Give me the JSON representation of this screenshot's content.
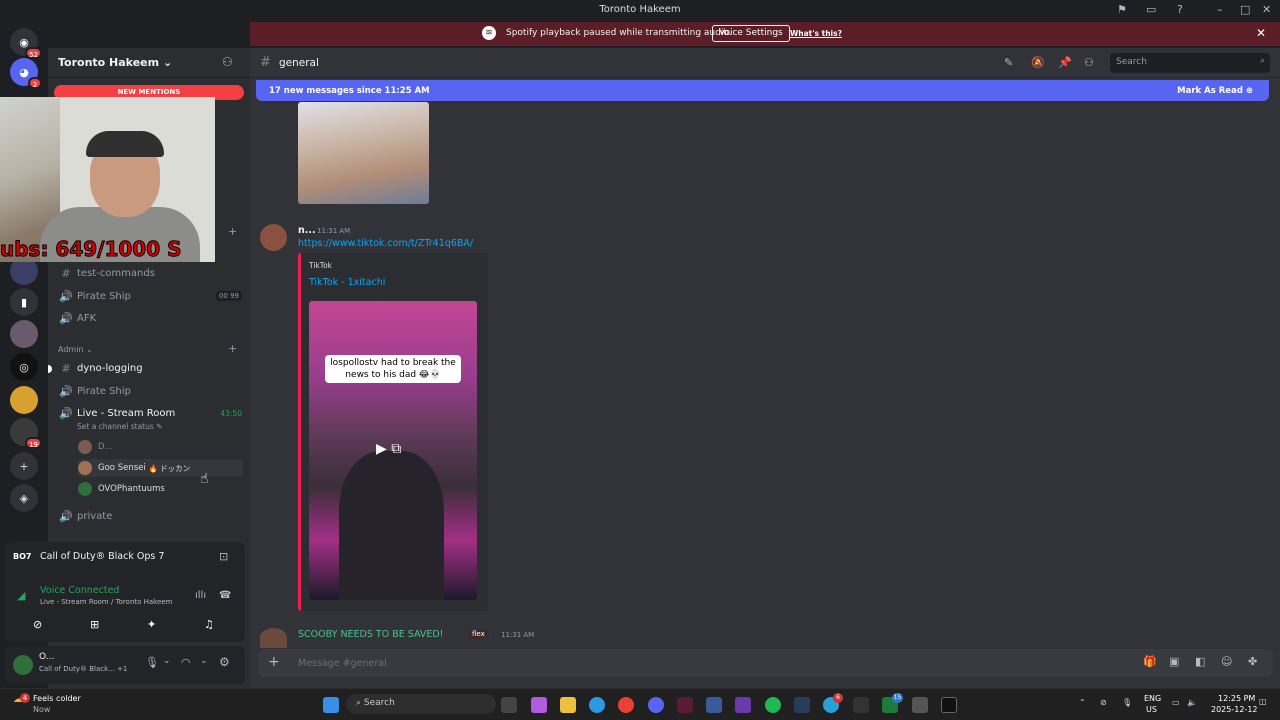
{
  "window": {
    "title": "Toronto Hakeem"
  },
  "notice": {
    "text": "Spotify playback paused while transmitting audio.",
    "voice_settings": "Voice Settings",
    "whats_this": "What's this?"
  },
  "server": {
    "name": "Toronto Hakeem",
    "new_mentions": "NEW MENTIONS"
  },
  "rail_badges": {
    "dm": "52",
    "discord": "2",
    "b1": "19"
  },
  "webcam": {
    "overlay_text": "ubs: 649/1000  S"
  },
  "channels": [
    {
      "icon": "#",
      "name": "test-commands"
    },
    {
      "icon": "🔊",
      "name": "Pirate Ship",
      "counts": "00  99"
    },
    {
      "icon": "🔊",
      "name": "AFK"
    }
  ],
  "admin": {
    "category": "Admin",
    "channels": [
      {
        "icon": "#",
        "name": "dyno-logging"
      },
      {
        "icon": "🔊",
        "name": "Pirate Ship"
      },
      {
        "icon": "🔊",
        "name": "Live - Stream Room",
        "timer": "43:50",
        "status": "Set a channel status"
      }
    ],
    "voice_users": [
      "D...",
      "Goo Sensei",
      "OVOPhantuums"
    ],
    "goo_tag": "🔥 ドッカン"
  },
  "private_channel": "private",
  "activity": {
    "game_logo": "BO7",
    "game": "Call of Duty® Black Ops 7",
    "voice_status": "Voice Connected",
    "voice_location": "Live - Stream Room / Toronto Hakeem"
  },
  "userpanel": {
    "name": "O...",
    "status": "Call of Duty® Black...",
    "extra": "+1"
  },
  "channel_header": {
    "hash": "#",
    "name": "general",
    "search_placeholder": "Search"
  },
  "new_messages": {
    "text": "17 new messages since 11:25 AM",
    "mark_read": "Mark As Read"
  },
  "messages": [
    {
      "author": "n...",
      "time": "11:31 AM",
      "link": "https://www.tiktok.com/t/ZTr41q6BA/",
      "embed": {
        "provider": "TikTok",
        "title": "TikTok - 1xitachi",
        "caption": "lospollostv had to break the news to his dad 😂💀"
      }
    },
    {
      "author": "SCOOBY NEEDS TO BE SAVED!",
      "tag": "flex",
      "time": "11:31 AM"
    }
  ],
  "composer": {
    "placeholder": "Message #general"
  },
  "taskbar": {
    "weather_title": "Feels colder",
    "weather_sub": "Now",
    "search": "Search",
    "lang1": "ENG",
    "lang2": "US",
    "time": "12:25 PM",
    "date": "2025-12-12",
    "weather_badge": "4",
    "tb_badge1": "6",
    "tb_badge2": "15"
  }
}
